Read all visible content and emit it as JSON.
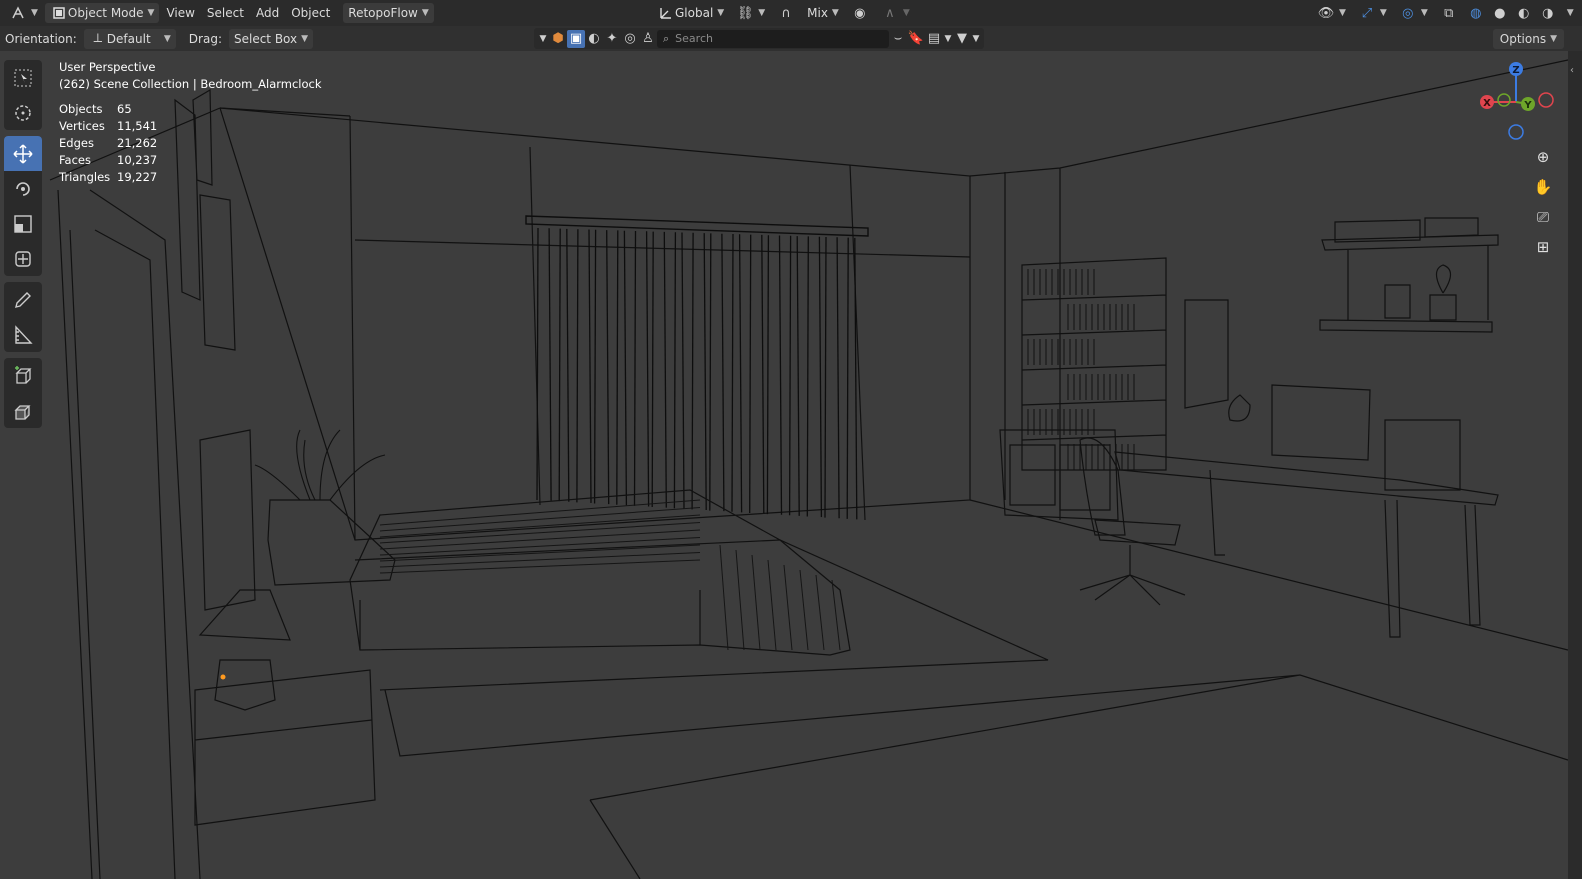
{
  "header": {
    "editor_icon": "3d-viewport-icon",
    "mode_label": "Object Mode",
    "menus": [
      "View",
      "Select",
      "Add",
      "Object"
    ],
    "addon_menu": "RetopoFlow",
    "transform_orientation": "Global",
    "snap_label": "Mix"
  },
  "toolbar": {
    "orientation_label": "Orientation:",
    "orientation_value": "Default",
    "drag_label": "Drag:",
    "drag_value": "Select Box",
    "search_placeholder": "Search",
    "options_label": "Options"
  },
  "tools": [
    "select-box",
    "cursor",
    "move",
    "rotate",
    "scale",
    "transform",
    "annotate",
    "measure",
    "add-cube",
    "add-object"
  ],
  "overlay": {
    "view_name": "User Perspective",
    "collection_line": "(262) Scene Collection | Bedroom_Alarmclock",
    "stats": [
      {
        "label": "Objects",
        "value": "65"
      },
      {
        "label": "Vertices",
        "value": "11,541"
      },
      {
        "label": "Edges",
        "value": "21,262"
      },
      {
        "label": "Faces",
        "value": "10,237"
      },
      {
        "label": "Triangles",
        "value": "19,227"
      }
    ]
  },
  "gizmo": {
    "x": "X",
    "y": "Y",
    "z": "Z"
  },
  "colors": {
    "accent": "#4772b3",
    "axis_x": "#e0454e",
    "axis_y": "#6ea52a",
    "axis_z": "#3c7ce3",
    "wire": "#0f0f0f",
    "background": "#3d3d3d"
  }
}
